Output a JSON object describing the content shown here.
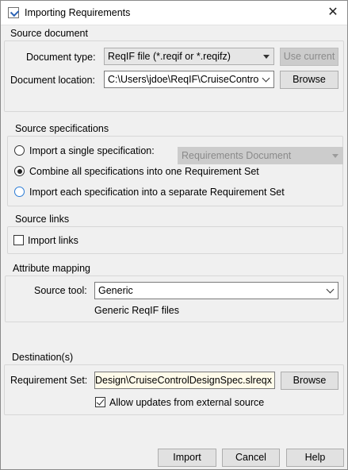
{
  "window": {
    "title": "Importing Requirements"
  },
  "source_document": {
    "title": "Source document",
    "doc_type_label": "Document type:",
    "doc_type_value": "ReqIF file (*.reqif or *.reqifz)",
    "use_current_label": "Use current",
    "doc_location_label": "Document location:",
    "doc_location_value": "C:\\Users\\jdoe\\ReqIF\\CruiseContro",
    "browse_label": "Browse"
  },
  "source_specifications": {
    "title": "Source specifications",
    "option_single": "Import a single specification:",
    "single_spec_value": "Requirements Document",
    "option_combine": "Combine all specifications into one Requirement Set",
    "option_separate": "Import each specification into a separate Requirement Set"
  },
  "source_links": {
    "title": "Source links",
    "import_links_label": "Import links"
  },
  "attribute_mapping": {
    "title": "Attribute mapping",
    "source_tool_label": "Source tool:",
    "source_tool_value": "Generic",
    "description": "Generic ReqIF files"
  },
  "destination": {
    "title": "Destination(s)",
    "req_set_label": "Requirement Set:",
    "req_set_value": "Design\\CruiseControlDesignSpec.slreqx",
    "browse_label": "Browse",
    "allow_updates_label": "Allow updates from external source"
  },
  "footer": {
    "import_label": "Import",
    "cancel_label": "Cancel",
    "help_label": "Help"
  },
  "colors": {
    "window_bg": "#f0f0f0",
    "field_highlight": "#fffbea",
    "radio_focus": "#2a7bd6"
  }
}
